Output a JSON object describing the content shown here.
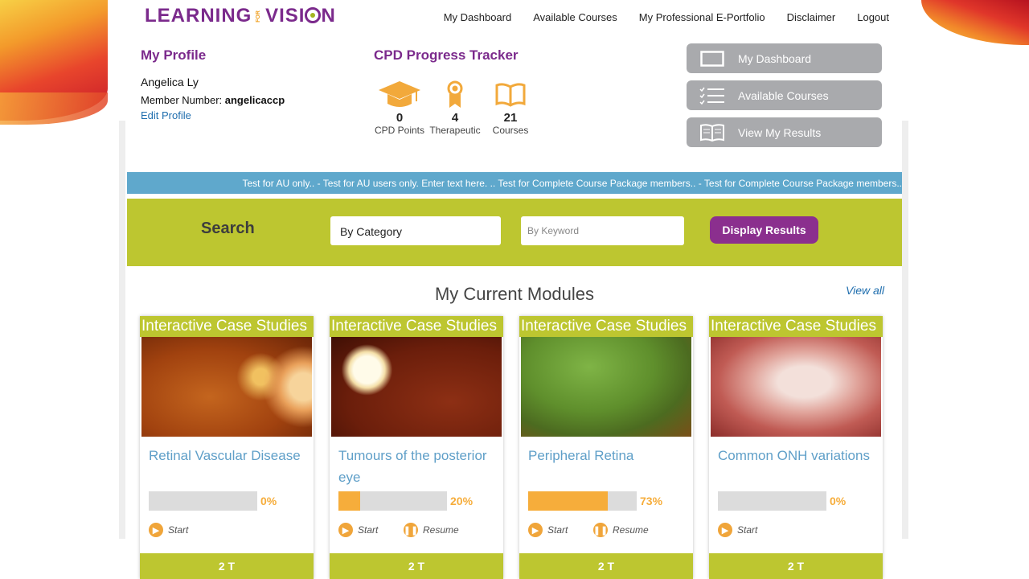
{
  "logo": {
    "part1": "LEARNING",
    "part2": "FOR",
    "part3": "VISI",
    "part4": "N"
  },
  "nav": [
    "My Dashboard",
    "Available Courses",
    "My Professional E-Portfolio",
    "Disclaimer",
    "Logout"
  ],
  "profile": {
    "title": "My Profile",
    "name": "Angelica Ly",
    "member_label": "Member Number:",
    "member_number": "angelicaccp",
    "edit": "Edit Profile"
  },
  "cpd": {
    "title": "CPD Progress Tracker",
    "items": [
      {
        "value": "0",
        "label": "CPD Points",
        "icon": "graduation-cap-icon"
      },
      {
        "value": "4",
        "label": "Therapeutic",
        "icon": "award-ribbon-icon"
      },
      {
        "value": "21",
        "label": "Courses",
        "icon": "open-book-icon"
      }
    ]
  },
  "side_buttons": [
    {
      "label": "My Dashboard",
      "icon": "monitor-icon"
    },
    {
      "label": "Available Courses",
      "icon": "checklist-icon"
    },
    {
      "label": "View My Results",
      "icon": "book-icon"
    }
  ],
  "ticker": "Test for AU only.. - Test for AU users only. Enter text here. .. Test for Complete Course Package members.. - Test for Complete Course Package members..",
  "search": {
    "label": "Search",
    "category": "By Category",
    "keyword_placeholder": "By Keyword",
    "button": "Display Results"
  },
  "modules": {
    "title": "My Current Modules",
    "view_all": "View all",
    "cards": [
      {
        "type": "Interactive Case Studies",
        "title": "Retinal Vascular Disease",
        "progress": 0,
        "progress_label": "0%",
        "actions": [
          "Start"
        ],
        "footer": "2 T"
      },
      {
        "type": "Interactive Case Studies",
        "title": "Tumours of the posterior eye",
        "progress": 20,
        "progress_label": "20%",
        "actions": [
          "Start",
          "Resume"
        ],
        "footer": "2 T"
      },
      {
        "type": "Interactive Case Studies",
        "title": "Peripheral Retina",
        "progress": 73,
        "progress_label": "73%",
        "actions": [
          "Start",
          "Resume"
        ],
        "footer": "2 T"
      },
      {
        "type": "Interactive Case Studies",
        "title": "Common ONH variations",
        "progress": 0,
        "progress_label": "0%",
        "actions": [
          "Start"
        ],
        "footer": "2 T"
      }
    ]
  },
  "colors": {
    "brand_purple": "#7b2a8c",
    "lime": "#bdc630",
    "ticker_blue": "#5fa8cc",
    "progress_orange": "#f6ad3b",
    "grey_button": "#a9aaad"
  }
}
